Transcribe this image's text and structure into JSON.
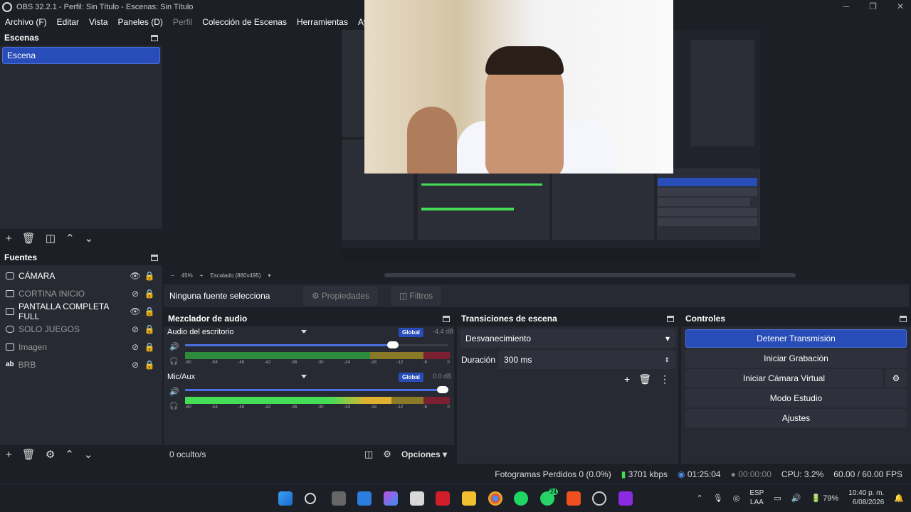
{
  "window": {
    "title": "OBS 32.2.1 - Perfil: Sin Título - Escenas: Sin Título"
  },
  "menu": [
    "Archivo (F)",
    "Editar",
    "Vista",
    "Paneles (D)",
    "Perfil",
    "Colección de Escenas",
    "Herramientas",
    "Ayuda (H)"
  ],
  "scenes": {
    "title": "Escenas",
    "items": [
      "Escena"
    ]
  },
  "sources": {
    "title": "Fuentes",
    "items": [
      {
        "name": "CÁMARA",
        "visible": true
      },
      {
        "name": "CORTINA INICIO",
        "visible": false
      },
      {
        "name": "PANTALLA COMPLETA FULL",
        "visible": true
      },
      {
        "name": "SOLO JUEGOS",
        "visible": false
      },
      {
        "name": "Imagen",
        "visible": false
      },
      {
        "name": "BRB",
        "visible": false
      }
    ]
  },
  "preview": {
    "zoom": "45%",
    "scale": "Escalado (880x495)"
  },
  "context": {
    "no_source": "Ninguna fuente selecciona",
    "properties": "Propiedades",
    "filters": "Filtros"
  },
  "mixer": {
    "title": "Mezclador de audio",
    "channels": [
      {
        "name": "Audio del escritorio",
        "global": "Global",
        "db": "-4.4 dB",
        "volume": 0.79,
        "level": 0
      },
      {
        "name": "Mic/Aux",
        "global": "Global",
        "db": "0.0 dB",
        "volume": 1.0,
        "level": 0.78
      }
    ],
    "ticks": [
      "-60",
      "-54",
      "-48",
      "-42",
      "-36",
      "-30",
      "-24",
      "-18",
      "-12",
      "-6",
      "0"
    ],
    "hidden": "0 oculto/s",
    "options": "Opciones"
  },
  "transitions": {
    "title": "Transiciones de escena",
    "selected": "Desvanecimiento",
    "duration_label": "Duración",
    "duration_value": "300 ms"
  },
  "controls": {
    "title": "Controles",
    "buttons": [
      "Detener Transmisión",
      "Iniciar Grabación",
      "Iniciar Cámara Virtual",
      "Modo Estudio",
      "Ajustes"
    ]
  },
  "status": {
    "dropped": "Fotogramas Perdidos 0 (0.0%)",
    "bitrate": "3701 kbps",
    "stream_time": "01:25:04",
    "rec_time": "00:00:00",
    "cpu": "CPU: 3.2%",
    "fps": "60.00 / 60.00 FPS"
  },
  "taskbar": {
    "lang1": "ESP",
    "lang2": "LAA",
    "battery": "79%",
    "time": "10:40 p. m.",
    "date": "6/08/2026",
    "badge": "24"
  }
}
